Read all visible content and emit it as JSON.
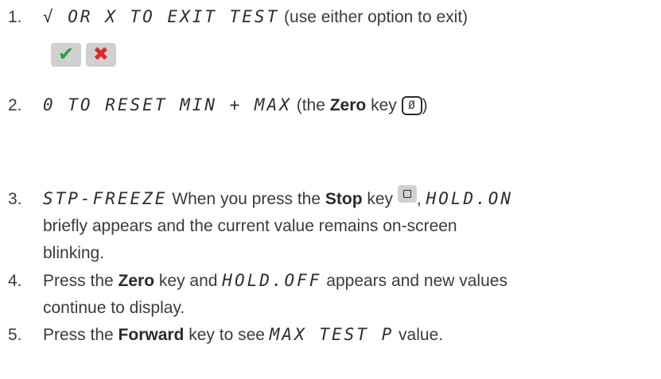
{
  "items": [
    {
      "number": "1.",
      "lcd": "√ OR X TO EXIT TEST",
      "text": " (use either option to exit)",
      "buttons": {
        "check_icon": "check-mark-icon",
        "x_icon": "x-mark-icon",
        "check_glyph": "✔",
        "x_glyph": "✖"
      }
    },
    {
      "number": "2.",
      "lcd": "0 TO RESET MIN + MAX",
      "text_before": " (the ",
      "bold": "Zero",
      "text_after": " key ",
      "key_glyph": "Ø",
      "text_end": ")"
    },
    {
      "number": "3.",
      "lcd": "STP-FREEZE",
      "text_before": " When you press the ",
      "bold": "Stop",
      "text_after": " key ",
      "comma": ", ",
      "lcd2": "HOLD.ON",
      "line2": "briefly appears and the current value remains on-screen",
      "line3": "blinking."
    },
    {
      "number": "4.",
      "text_before": "Press the ",
      "bold": "Zero",
      "text_after": " key and ",
      "lcd": "HOLD.OFF",
      "text_end": " appears and new values",
      "line2": "continue to display."
    },
    {
      "number": "5.",
      "text_before": "Press the ",
      "bold": "Forward",
      "text_after": " key to see ",
      "lcd": "MAX TEST P",
      "text_end": "  value."
    }
  ],
  "colors": {
    "check": "#1fa33a",
    "x": "#e0262b",
    "button_bg": "#d0d0d0"
  }
}
